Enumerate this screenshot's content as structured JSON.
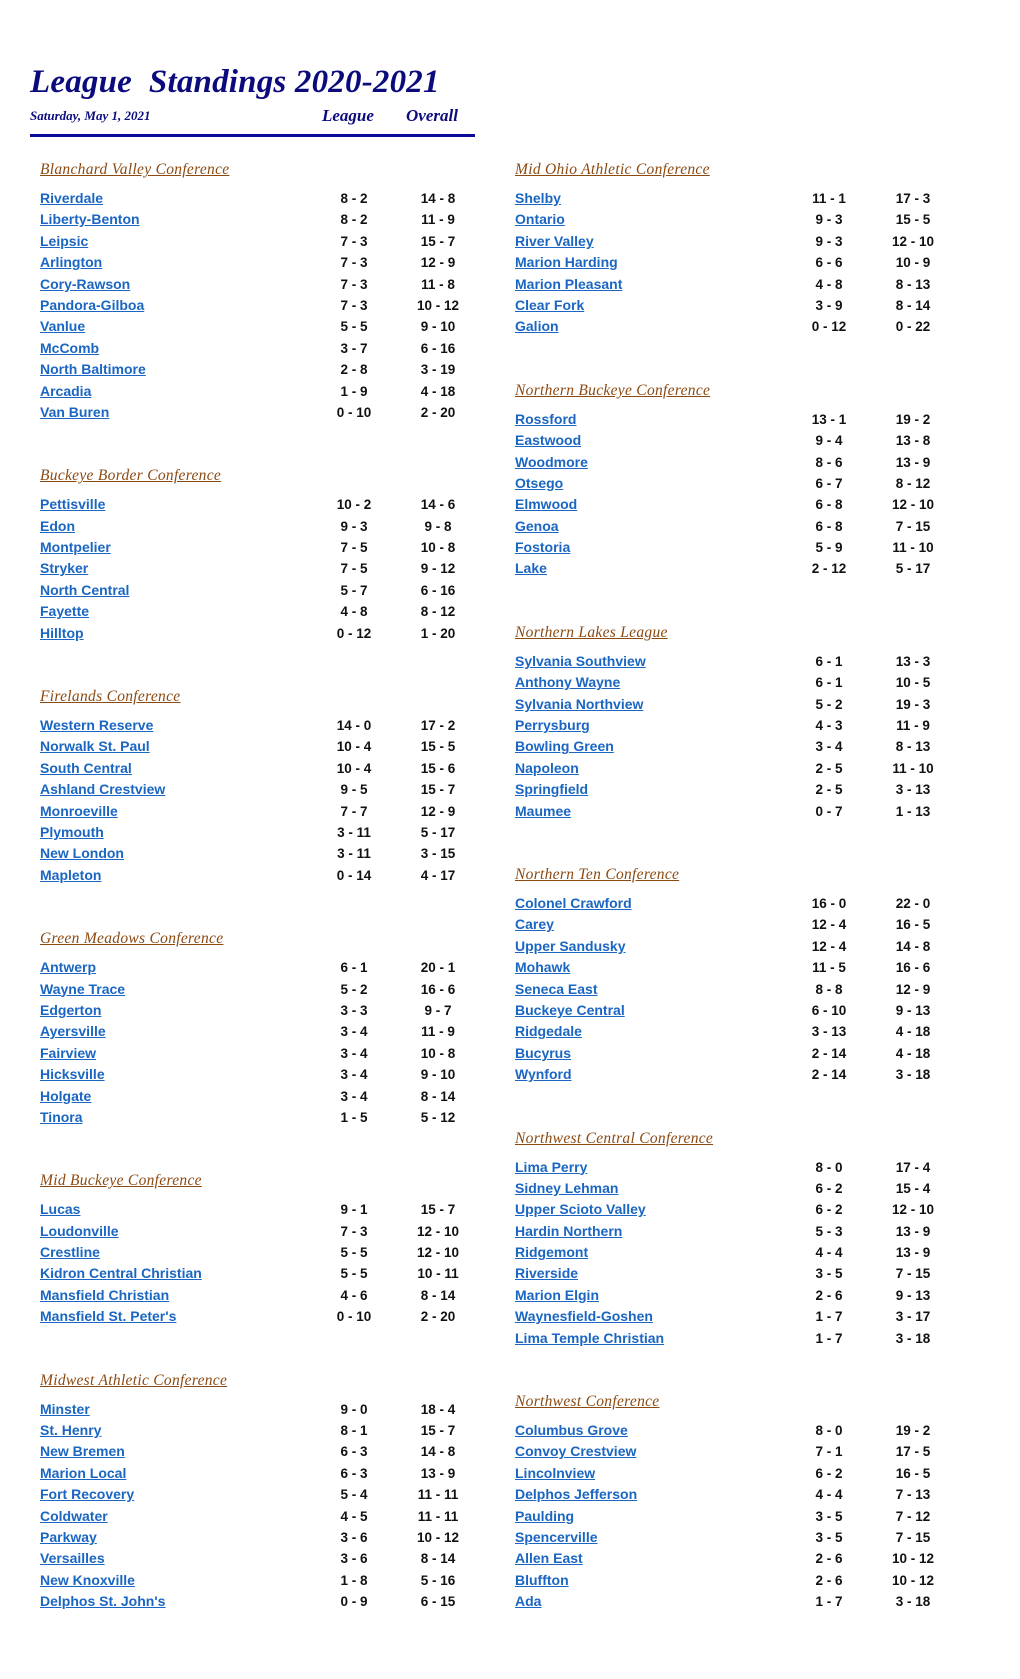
{
  "header": {
    "title": "League  Standings 2020-2021",
    "date": "Saturday, May 1, 2021",
    "league_label": "League",
    "overall_label": "Overall"
  },
  "colors": {
    "title": "#0b0b7d",
    "conference_title": "#8b4a12",
    "team_link": "#1a66c2",
    "record": "#111111"
  },
  "left_conferences": [
    {
      "name": "Blanchard Valley Conference",
      "teams": [
        {
          "name": "Riverdale",
          "league": "8 - 2",
          "overall": "14 - 8"
        },
        {
          "name": "Liberty-Benton",
          "league": "8 - 2",
          "overall": "11 - 9"
        },
        {
          "name": "Leipsic",
          "league": "7 - 3",
          "overall": "15 - 7"
        },
        {
          "name": "Arlington",
          "league": "7 - 3",
          "overall": "12 - 9"
        },
        {
          "name": "Cory-Rawson",
          "league": "7 - 3",
          "overall": "11 - 8"
        },
        {
          "name": "Pandora-Gilboa",
          "league": "7 - 3",
          "overall": "10 - 12"
        },
        {
          "name": "Vanlue",
          "league": "5 - 5",
          "overall": "9 - 10"
        },
        {
          "name": "McComb",
          "league": "3 - 7",
          "overall": "6 - 16"
        },
        {
          "name": "North Baltimore",
          "league": "2 - 8",
          "overall": "3 - 19"
        },
        {
          "name": "Arcadia",
          "league": "1 - 9",
          "overall": "4 - 18"
        },
        {
          "name": "Van Buren",
          "league": "0 - 10",
          "overall": "2 - 20"
        }
      ]
    },
    {
      "name": "Buckeye Border Conference",
      "teams": [
        {
          "name": "Pettisville",
          "league": "10 - 2",
          "overall": "14 - 6"
        },
        {
          "name": "Edon",
          "league": "9 - 3",
          "overall": "9 - 8"
        },
        {
          "name": "Montpelier",
          "league": "7 - 5",
          "overall": "10 - 8"
        },
        {
          "name": "Stryker",
          "league": "7 - 5",
          "overall": "9 - 12"
        },
        {
          "name": "North Central",
          "league": "5 - 7",
          "overall": "6 - 16"
        },
        {
          "name": "Fayette",
          "league": "4 - 8",
          "overall": "8 - 12"
        },
        {
          "name": "Hilltop",
          "league": "0 - 12",
          "overall": "1 - 20"
        }
      ]
    },
    {
      "name": "Firelands Conference",
      "teams": [
        {
          "name": "Western Reserve",
          "league": "14 - 0",
          "overall": "17 - 2"
        },
        {
          "name": "Norwalk St. Paul",
          "league": "10 - 4",
          "overall": "15 - 5"
        },
        {
          "name": "South Central",
          "league": "10 - 4",
          "overall": "15 - 6"
        },
        {
          "name": "Ashland Crestview",
          "league": "9 - 5",
          "overall": "15 - 7"
        },
        {
          "name": "Monroeville",
          "league": "7 - 7",
          "overall": "12 - 9"
        },
        {
          "name": "Plymouth",
          "league": "3 - 11",
          "overall": "5 - 17"
        },
        {
          "name": "New London",
          "league": "3 - 11",
          "overall": "3 - 15"
        },
        {
          "name": "Mapleton",
          "league": "0 - 14",
          "overall": "4 - 17"
        }
      ]
    },
    {
      "name": "Green Meadows Conference",
      "teams": [
        {
          "name": "Antwerp",
          "league": "6 - 1",
          "overall": "20 - 1"
        },
        {
          "name": "Wayne Trace",
          "league": "5 - 2",
          "overall": "16 - 6"
        },
        {
          "name": "Edgerton",
          "league": "3 - 3",
          "overall": "9 - 7"
        },
        {
          "name": "Ayersville",
          "league": "3 - 4",
          "overall": "11 - 9"
        },
        {
          "name": "Fairview",
          "league": "3 - 4",
          "overall": "10 - 8"
        },
        {
          "name": "Hicksville",
          "league": "3 - 4",
          "overall": "9 - 10"
        },
        {
          "name": "Holgate",
          "league": "3 - 4",
          "overall": "8 - 14"
        },
        {
          "name": "Tinora",
          "league": "1 - 5",
          "overall": "5 - 12"
        }
      ]
    },
    {
      "name": "Mid Buckeye Conference",
      "teams": [
        {
          "name": "Lucas",
          "league": "9 - 1",
          "overall": "15 - 7"
        },
        {
          "name": "Loudonville",
          "league": "7 - 3",
          "overall": "12 - 10"
        },
        {
          "name": "Crestline",
          "league": "5 - 5",
          "overall": "12 - 10"
        },
        {
          "name": "Kidron Central Christian",
          "league": "5 - 5",
          "overall": "10 - 11"
        },
        {
          "name": "Mansfield Christian",
          "league": "4 - 6",
          "overall": "8 - 14"
        },
        {
          "name": "Mansfield St. Peter's",
          "league": "0 - 10",
          "overall": "2 - 20"
        }
      ]
    },
    {
      "name": "Midwest Athletic Conference",
      "teams": [
        {
          "name": "Minster",
          "league": "9 - 0",
          "overall": "18 - 4"
        },
        {
          "name": "St. Henry",
          "league": "8 - 1",
          "overall": "15 - 7"
        },
        {
          "name": "New Bremen",
          "league": "6 - 3",
          "overall": "14 - 8"
        },
        {
          "name": "Marion Local",
          "league": "6 - 3",
          "overall": "13 - 9"
        },
        {
          "name": "Fort Recovery",
          "league": "5 - 4",
          "overall": "11 - 11"
        },
        {
          "name": "Coldwater",
          "league": "4 - 5",
          "overall": "11 - 11"
        },
        {
          "name": "Parkway",
          "league": "3 - 6",
          "overall": "10 - 12"
        },
        {
          "name": "Versailles",
          "league": "3 - 6",
          "overall": "8 - 14"
        },
        {
          "name": "New Knoxville",
          "league": "1 - 8",
          "overall": "5 - 16"
        },
        {
          "name": "Delphos St. John's",
          "league": "0 - 9",
          "overall": "6 - 15"
        }
      ]
    }
  ],
  "right_conferences": [
    {
      "name": "Mid Ohio Athletic Conference",
      "teams": [
        {
          "name": "Shelby",
          "league": "11 - 1",
          "overall": "17 - 3"
        },
        {
          "name": "Ontario",
          "league": "9 - 3",
          "overall": "15 - 5"
        },
        {
          "name": "River Valley",
          "league": "9 - 3",
          "overall": "12 - 10"
        },
        {
          "name": "Marion Harding",
          "league": "6 - 6",
          "overall": "10 - 9"
        },
        {
          "name": "Marion Pleasant",
          "league": "4 - 8",
          "overall": "8 - 13"
        },
        {
          "name": "Clear Fork",
          "league": "3 - 9",
          "overall": "8 - 14"
        },
        {
          "name": "Galion",
          "league": "0 - 12",
          "overall": "0 - 22"
        }
      ]
    },
    {
      "name": "Northern Buckeye Conference",
      "teams": [
        {
          "name": "Rossford",
          "league": "13 - 1",
          "overall": "19 - 2"
        },
        {
          "name": "Eastwood",
          "league": "9 - 4",
          "overall": "13 - 8"
        },
        {
          "name": "Woodmore",
          "league": "8 - 6",
          "overall": "13 - 9"
        },
        {
          "name": "Otsego",
          "league": "6 - 7",
          "overall": "8 - 12"
        },
        {
          "name": "Elmwood",
          "league": "6 - 8",
          "overall": "12 - 10"
        },
        {
          "name": "Genoa",
          "league": "6 - 8",
          "overall": "7 - 15"
        },
        {
          "name": "Fostoria",
          "league": "5 - 9",
          "overall": "11 - 10"
        },
        {
          "name": "Lake",
          "league": "2 - 12",
          "overall": "5 - 17"
        }
      ]
    },
    {
      "name": "Northern Lakes League",
      "teams": [
        {
          "name": "Sylvania Southview",
          "league": "6 - 1",
          "overall": "13 - 3"
        },
        {
          "name": "Anthony Wayne",
          "league": "6 - 1",
          "overall": "10 - 5"
        },
        {
          "name": "Sylvania Northview",
          "league": "5 - 2",
          "overall": "19 - 3"
        },
        {
          "name": "Perrysburg",
          "league": "4 - 3",
          "overall": "11 - 9"
        },
        {
          "name": "Bowling Green",
          "league": "3 - 4",
          "overall": "8 - 13"
        },
        {
          "name": "Napoleon",
          "league": "2 - 5",
          "overall": "11 - 10"
        },
        {
          "name": "Springfield",
          "league": "2 - 5",
          "overall": "3 - 13"
        },
        {
          "name": "Maumee",
          "league": "0 - 7",
          "overall": "1 - 13"
        }
      ]
    },
    {
      "name": "Northern Ten Conference",
      "teams": [
        {
          "name": "Colonel Crawford",
          "league": "16 - 0",
          "overall": "22 - 0"
        },
        {
          "name": "Carey",
          "league": "12 - 4",
          "overall": "16 - 5"
        },
        {
          "name": "Upper Sandusky",
          "league": "12 - 4",
          "overall": "14 - 8"
        },
        {
          "name": "Mohawk",
          "league": "11 - 5",
          "overall": "16 - 6"
        },
        {
          "name": "Seneca East",
          "league": "8 - 8",
          "overall": "12 - 9"
        },
        {
          "name": "Buckeye Central",
          "league": "6 - 10",
          "overall": "9 - 13"
        },
        {
          "name": "Ridgedale",
          "league": "3 - 13",
          "overall": "4 - 18"
        },
        {
          "name": "Bucyrus",
          "league": "2 - 14",
          "overall": "4 - 18"
        },
        {
          "name": "Wynford",
          "league": "2 - 14",
          "overall": "3 - 18"
        }
      ]
    },
    {
      "name": "Northwest Central Conference",
      "teams": [
        {
          "name": "Lima Perry",
          "league": "8 - 0",
          "overall": "17 - 4"
        },
        {
          "name": "Sidney Lehman",
          "league": "6 - 2",
          "overall": "15 - 4"
        },
        {
          "name": "Upper Scioto Valley",
          "league": "6 - 2",
          "overall": "12 - 10"
        },
        {
          "name": "Hardin Northern",
          "league": "5 - 3",
          "overall": "13 - 9"
        },
        {
          "name": "Ridgemont",
          "league": "4 - 4",
          "overall": "13 - 9"
        },
        {
          "name": "Riverside",
          "league": "3 - 5",
          "overall": "7 - 15"
        },
        {
          "name": "Marion Elgin",
          "league": "2 - 6",
          "overall": "9 - 13"
        },
        {
          "name": "Waynesfield-Goshen",
          "league": "1 - 7",
          "overall": "3 - 17"
        },
        {
          "name": "Lima Temple Christian",
          "league": "1 - 7",
          "overall": "3 - 18"
        }
      ]
    },
    {
      "name": "Northwest Conference",
      "teams": [
        {
          "name": "Columbus Grove",
          "league": "8 - 0",
          "overall": "19 - 2"
        },
        {
          "name": "Convoy Crestview",
          "league": "7 - 1",
          "overall": "17 - 5"
        },
        {
          "name": "Lincolnview",
          "league": "6 - 2",
          "overall": "16 - 5"
        },
        {
          "name": "Delphos Jefferson",
          "league": "4 - 4",
          "overall": "7 - 13"
        },
        {
          "name": "Paulding",
          "league": "3 - 5",
          "overall": "7 - 12"
        },
        {
          "name": "Spencerville",
          "league": "3 - 5",
          "overall": "7 - 15"
        },
        {
          "name": "Allen East",
          "league": "2 - 6",
          "overall": "10 - 12"
        },
        {
          "name": "Bluffton",
          "league": "2 - 6",
          "overall": "10 - 12"
        },
        {
          "name": "Ada",
          "league": "1 - 7",
          "overall": "3 - 18"
        }
      ]
    }
  ]
}
